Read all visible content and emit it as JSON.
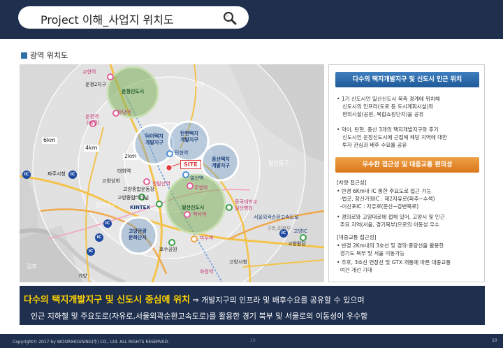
{
  "header": {
    "title": "Project 이해_사업지 위치도",
    "search_icon": "search-icon"
  },
  "section": {
    "label": "광역 위치도"
  },
  "map": {
    "site_label": "SITE",
    "radius_labels": [
      "6km",
      "4km",
      "2km"
    ],
    "district_labels": [
      [
        "운정신도시"
      ],
      [
        "덕이택지",
        "개발지구"
      ],
      [
        "탄현택지",
        "개발지구"
      ],
      [
        "중산택지",
        "개발지구"
      ],
      [
        "일산신도시"
      ],
      [
        "고양관광",
        "문화단지"
      ]
    ],
    "place_labels": {
      "paju": "파주",
      "ilsan_donggu": "일산동구",
      "gimpo": "김포",
      "ilsan_seogu": "일산서구",
      "goyang_wondang": "고양원당",
      "guri_uijeongbu": "구리,의정부",
      "seoul_ring": "서울외곽순환고속도로",
      "goyang_ic": "고양IC",
      "gayang": "가양",
      "ic": "IC",
      "tanhyeon": "탄현역",
      "ilsan_station": "일산역",
      "jeongbalsan": "정발산역",
      "juyeop": "주엽역",
      "baekseok": "백석역",
      "madu": "마두역",
      "hwajeong": "화정역",
      "daehwa": "대화역",
      "kintex": "KINTEX",
      "goyang_terminal": "고양종합터미널",
      "dongguk": "동국대학교",
      "ilsan_hospital": "일산병원",
      "lake_park": "호수공원",
      "goyang_sports": "고양종합운동장",
      "gov_office": "고양시청",
      "unjeong_station": "운정역",
      "yadang_station": "야당역",
      "gyohyeon_station": "교현역",
      "planned": "(예정)",
      "unjeong_2": "운정2지구",
      "paju_city_area": "파주시청",
      "goyang_market": "고양상회"
    }
  },
  "panel": {
    "box1_title": "다수의 택지개발지구 및 신도시 인근 위치",
    "box1_bullets": [
      [
        "1기 신도시인 일산신도시 북측 경계에 위치해",
        "신도시의 인프라(도로 등 도시계획시설)와",
        "편의시설(공원, 복합쇼핑단지)을 공유"
      ],
      [
        "덕이, 탄현, 중산 3개의 택지개발지구와 후기",
        "신도시인 운정신도시에 근접해 해당 지역에 대한",
        "투자 관심과 배후 수요를 공유"
      ]
    ],
    "box2_title": "우수한 접근성 및 대중교통 편의성",
    "car_heading": "[차량 접근성]",
    "car_lines": [
      "• 반경 6Km내 IC 통한 주요도로 접근 가능",
      "  -법곳, 장산가좌IC : 제2자유로(파주~수색)",
      "  -이산포IC : 자유로(문산~강변북로)",
      "• 경의로와 고양대로에 접해 있어, 고양시 및 인근",
      "  주요 지역(서울, 경기북부)으로의 이동성 우수"
    ],
    "transit_heading": "[대중교통 접근성]",
    "transit_lines": [
      "• 반경 2Km내의 3호선 및 경의·중앙선을 활용한",
      "  경기도 북부 및 서울 이동가능",
      "• 추후, 3호선 연장선 및 GTX 개통에 따른 대중교통",
      "  여건 개선 기대"
    ]
  },
  "banner": {
    "line1_emphasis": "다수의 택지개발지구 및 신도시 중심에 위치",
    "line1_arrow": " ⇒ ",
    "line1_rest": "개발지구의 인프라 및 배후수요를 공유할 수 있으며",
    "line2": "인근 지하철 및 주요도로(자유로,서울외곽순환고속도로)를 활용한 경기 북부 및 서울로의 이동성이 우수함"
  },
  "footer": {
    "copyright": "Copyright© 2017 by WOORIHOUSING(주) CO., Ltd. ALL RIGHTS RESERVED.",
    "page_center": "10",
    "page": "10"
  },
  "colors": {
    "navy": "#1f2f4e",
    "highlight_yellow": "#ffd400",
    "panel_blue": "#2e6fa7",
    "panel_orange": "#e08a2a",
    "site_red": "#e04040",
    "district_green": "#7fb15a",
    "district_blue": "#5b8fc4"
  }
}
